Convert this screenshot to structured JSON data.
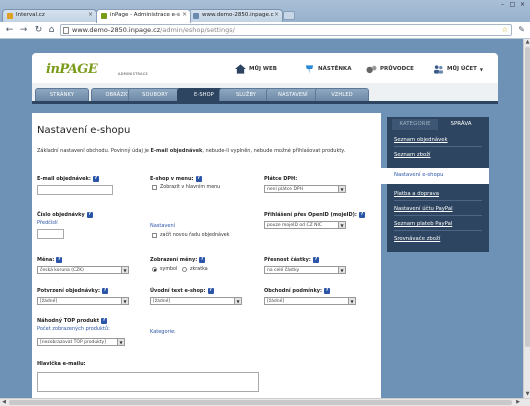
{
  "browser": {
    "tabs": [
      {
        "title": "Interval.cz"
      },
      {
        "title": "inPage - Administrace e-s"
      },
      {
        "title": "www.demo-2850.inpage.c"
      }
    ],
    "url_host": "www.demo-2850.inpage.cz",
    "url_path": "/admin/eshop/settings/"
  },
  "site": {
    "logo_main": "inPAGE",
    "logo_sub": "ADMINISTRACE",
    "topnav": [
      {
        "label": "MŮJ WEB",
        "icon": "home-icon"
      },
      {
        "label": "NÁSTĚNKA",
        "icon": "pin-icon"
      },
      {
        "label": "PRŮVODCE",
        "icon": "guide-icon"
      },
      {
        "label": "MŮJ ÚČET",
        "icon": "users-icon"
      }
    ],
    "mainnav": [
      "STRÁNKY",
      "OBRÁZKY",
      "SOUBORY",
      "E-SHOP",
      "SLUŽBY",
      "NASTAVENÍ",
      "VZHLED"
    ],
    "mainnav_active": "E-SHOP"
  },
  "content": {
    "title": "Nastavení e-shopu",
    "intro_pre": "Základní nastavení obchodu. Povinný údaj je ",
    "intro_bold": "E-mail objednávek",
    "intro_post": ", nebude-li vyplněn, nebude možné přihlašovat produkty.",
    "help": "?",
    "fields": {
      "email_label": "E-mail objednávek:",
      "eshop_menu_label": "E-shop v menu:",
      "eshop_menu_check": "Zobrazit v hlavním menu",
      "vat_label": "Plátce DPH:",
      "vat_value": "není plátce DPH",
      "order_no_label": "Číslo objednávky",
      "prefix_link": "Předčíslí",
      "settings_link": "Nastavení",
      "new_row_check": "začít novou řadu objednávek",
      "openid_label": "Přihlášení přes OpenID (mojeID):",
      "openid_value": "pouze mojeID od CZ NIC",
      "currency_label": "Měna:",
      "currency_value": "česká koruna (CZK)",
      "display_label": "Zobrazení měny:",
      "radio_symbol": "symbol",
      "radio_code": "zkratka",
      "precision_label": "Přesnost částky:",
      "precision_value": "na celé částky",
      "confirm_label": "Potvrzení objednávky:",
      "confirm_value": "[žádné]",
      "intro_text_label": "Úvodní text e-shop:",
      "intro_text_value": "[žádné]",
      "terms_label": "Obchodní podmínky:",
      "terms_value": "[žádné]",
      "random_top_label": "Náhodný TOP produkt",
      "count_link": "Počet zobrazených produktů:",
      "count_value": "[nezobrazovat TOP produkty]",
      "category_link": "Kategorie:",
      "header_label": "Hlavička e-mailu:"
    }
  },
  "sidebar": {
    "tabs": [
      "KATEGORIE",
      "SPRÁVA"
    ],
    "active_tab": "SPRÁVA",
    "items": [
      "Seznam objednávek",
      "Seznam zboží",
      "Nastavení e-shopu",
      "Platba a doprava",
      "Nastavení účtu PayPal",
      "Seznam plateb PayPal",
      "Srovnávače zboží"
    ],
    "active_item": "Nastavení e-shopu"
  },
  "colors": {
    "nav_dark": "#2d4560",
    "link": "#2a55a8",
    "logo_green": "#7a9a1a"
  }
}
